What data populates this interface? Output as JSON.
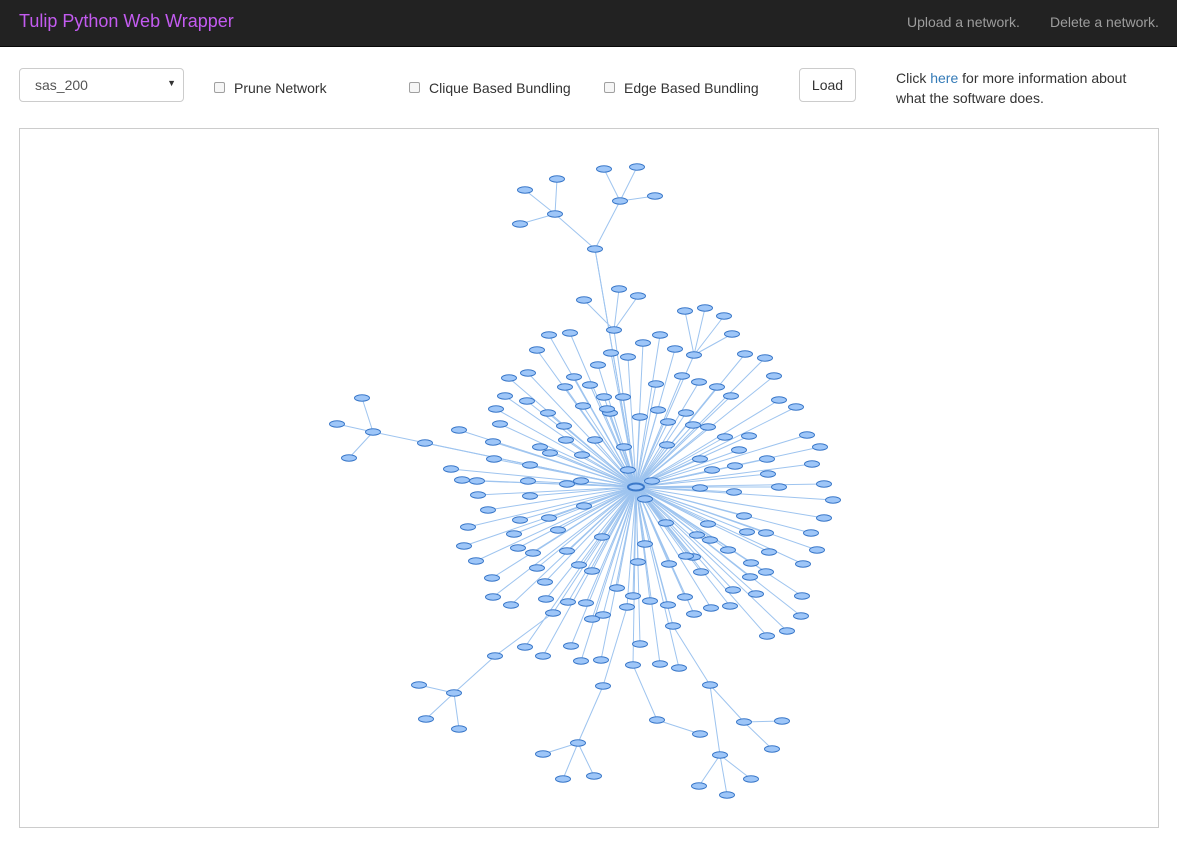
{
  "navbar": {
    "brand": "Tulip Python Web Wrapper",
    "links": [
      "Upload a network.",
      "Delete a network."
    ]
  },
  "controls": {
    "network_select": {
      "value": "sas_200"
    },
    "prune_label": "Prune Network",
    "clique_label": "Clique Based Bundling",
    "edge_label": "Edge Based Bundling",
    "load_label": "Load",
    "info_prefix": "Click ",
    "info_link": "here",
    "info_suffix": " for more information about what the software does."
  },
  "graph": {
    "node_fill": "#9ec6f8",
    "node_stroke": "#3a78c9",
    "edge_color": "#9ec4ef"
  }
}
